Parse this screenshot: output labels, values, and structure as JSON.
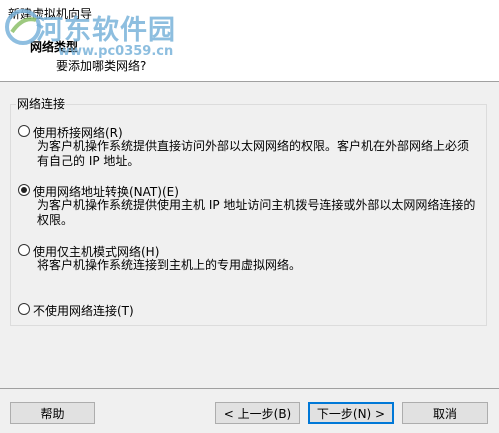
{
  "window": {
    "title": "新建虚拟机向导"
  },
  "header": {
    "heading": "网络类型",
    "subheading": "要添加哪类网络?"
  },
  "watermark": {
    "name": "河东软件园",
    "url": "www.pc0359.cn"
  },
  "group": {
    "label": "网络连接"
  },
  "options": [
    {
      "label": "使用桥接网络(R)",
      "selected": false,
      "description": "为客户机操作系统提供直接访问外部以太网网络的权限。客户机在外部网络上必须有自己的 IP 地址。"
    },
    {
      "label": "使用网络地址转换(NAT)(E)",
      "selected": true,
      "description": "为客户机操作系统提供使用主机 IP 地址访问主机拨号连接或外部以太网网络连接的权限。"
    },
    {
      "label": "使用仅主机模式网络(H)",
      "selected": false,
      "description": "将客户机操作系统连接到主机上的专用虚拟网络。"
    },
    {
      "label": "不使用网络连接(T)",
      "selected": false,
      "description": ""
    }
  ],
  "buttons": {
    "help": "帮助",
    "back": "< 上一步(B)",
    "next": "下一步(N) >",
    "cancel": "取消"
  }
}
